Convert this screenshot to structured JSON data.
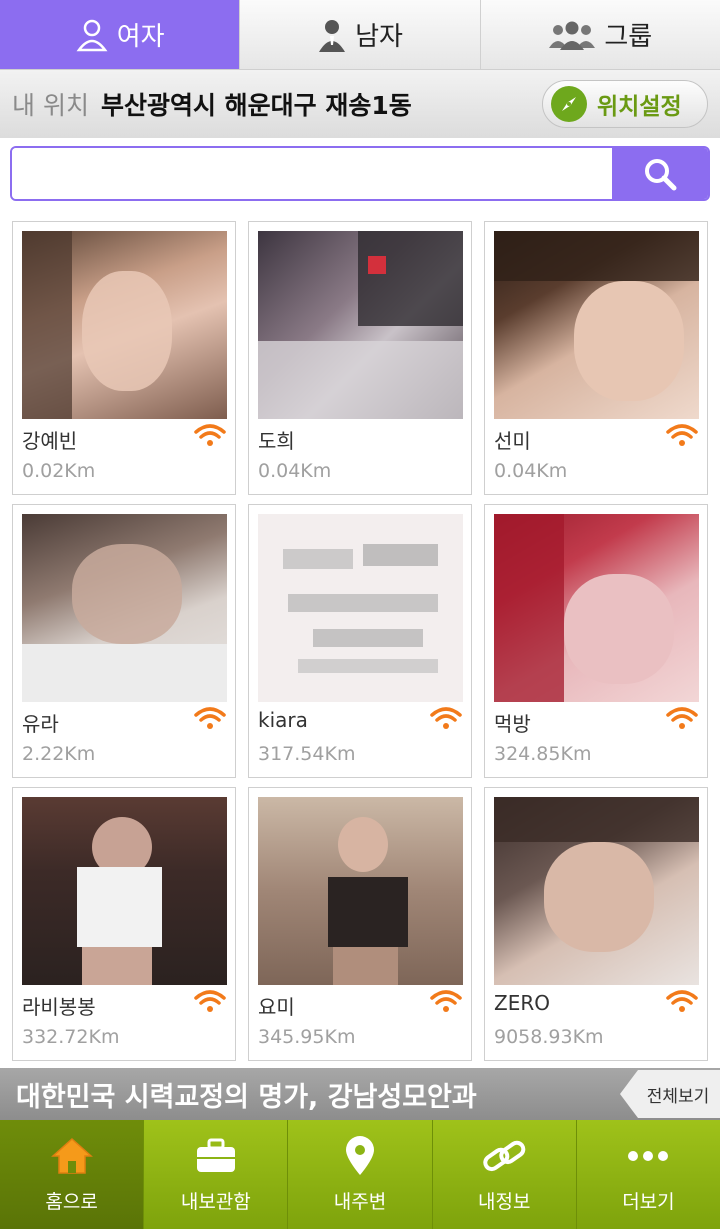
{
  "tabs": [
    {
      "label": "여자",
      "icon": "female-user-icon",
      "active": true
    },
    {
      "label": "남자",
      "icon": "male-user-icon",
      "active": false
    },
    {
      "label": "그룹",
      "icon": "group-icon",
      "active": false
    }
  ],
  "location": {
    "label": "내 위치",
    "value": "부산광역시 해운대구 재송1동",
    "button_label": "위치설정"
  },
  "search": {
    "value": "",
    "placeholder": ""
  },
  "profiles": [
    {
      "name": "강예빈",
      "distance": "0.02Km"
    },
    {
      "name": "도희",
      "distance": "0.04Km"
    },
    {
      "name": "선미",
      "distance": "0.04Km"
    },
    {
      "name": "유라",
      "distance": "2.22Km"
    },
    {
      "name": "kiara",
      "distance": "317.54Km"
    },
    {
      "name": "먹방",
      "distance": "324.85Km"
    },
    {
      "name": "라비봉봉",
      "distance": "332.72Km"
    },
    {
      "name": "요미",
      "distance": "345.95Km"
    },
    {
      "name": "ZERO",
      "distance": "9058.93Km"
    }
  ],
  "banner": {
    "text": "대한민국 시력교정의 명가, 강남성모안과",
    "more_label": "전체보기"
  },
  "bottom_nav": [
    {
      "label": "홈으로",
      "icon": "home-icon",
      "active": true
    },
    {
      "label": "내보관함",
      "icon": "briefcase-icon",
      "active": false
    },
    {
      "label": "내주변",
      "icon": "map-pin-icon",
      "active": false
    },
    {
      "label": "내정보",
      "icon": "link-icon",
      "active": false
    },
    {
      "label": "더보기",
      "icon": "more-dots-icon",
      "active": false
    }
  ],
  "colors": {
    "accent_purple": "#8c6df0",
    "nav_green": "#8cb414",
    "wifi_orange": "#f27a1a"
  }
}
